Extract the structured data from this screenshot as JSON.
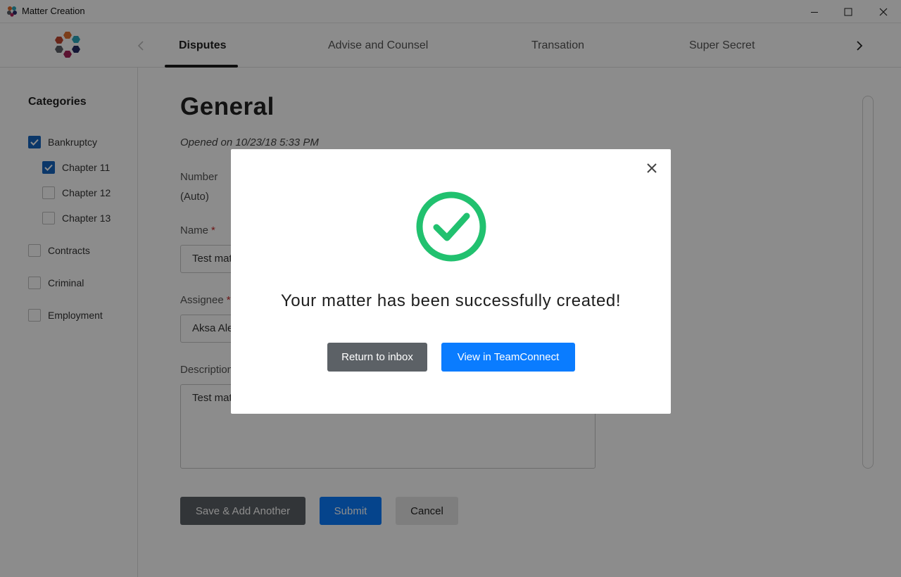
{
  "window": {
    "title": "Matter Creation"
  },
  "tabs": [
    {
      "label": "Disputes",
      "active": true
    },
    {
      "label": "Advise and Counsel",
      "active": false
    },
    {
      "label": "Transation",
      "active": false
    },
    {
      "label": "Super Secret",
      "active": false
    }
  ],
  "sidebar": {
    "heading": "Categories",
    "items": [
      {
        "label": "Bankruptcy",
        "checked": true
      },
      {
        "label": "Chapter 11",
        "checked": true
      },
      {
        "label": "Chapter 12",
        "checked": false
      },
      {
        "label": "Chapter 13",
        "checked": false
      },
      {
        "label": "Contracts",
        "checked": false
      },
      {
        "label": "Criminal",
        "checked": false
      },
      {
        "label": "Employment",
        "checked": false
      }
    ]
  },
  "form": {
    "title": "General",
    "opened": "Opened on 10/23/18 5:33 PM",
    "number_label": "Number",
    "number_value": "(Auto)",
    "name_label": "Name",
    "name_value": "Test mat",
    "assignee_label": "Assignee",
    "assignee_value": "Aksa Ale",
    "description_label": "Description",
    "description_value": "Test mat",
    "required_marker": "*"
  },
  "actions": {
    "save_add": "Save & Add Another",
    "submit": "Submit",
    "cancel": "Cancel"
  },
  "modal": {
    "message": "Your matter has been successfully created!",
    "return_label": "Return to inbox",
    "view_label": "View in TeamConnect"
  },
  "colors": {
    "accent_blue": "#0a7cff",
    "success_green": "#21c16f",
    "checkbox_blue": "#1565c0",
    "button_dark": "#5c6166"
  },
  "icons": [
    "app-logo-icon",
    "minimize-icon",
    "maximize-icon",
    "close-icon",
    "chevron-left-icon",
    "chevron-right-icon",
    "checkmark-icon",
    "success-check-icon"
  ]
}
